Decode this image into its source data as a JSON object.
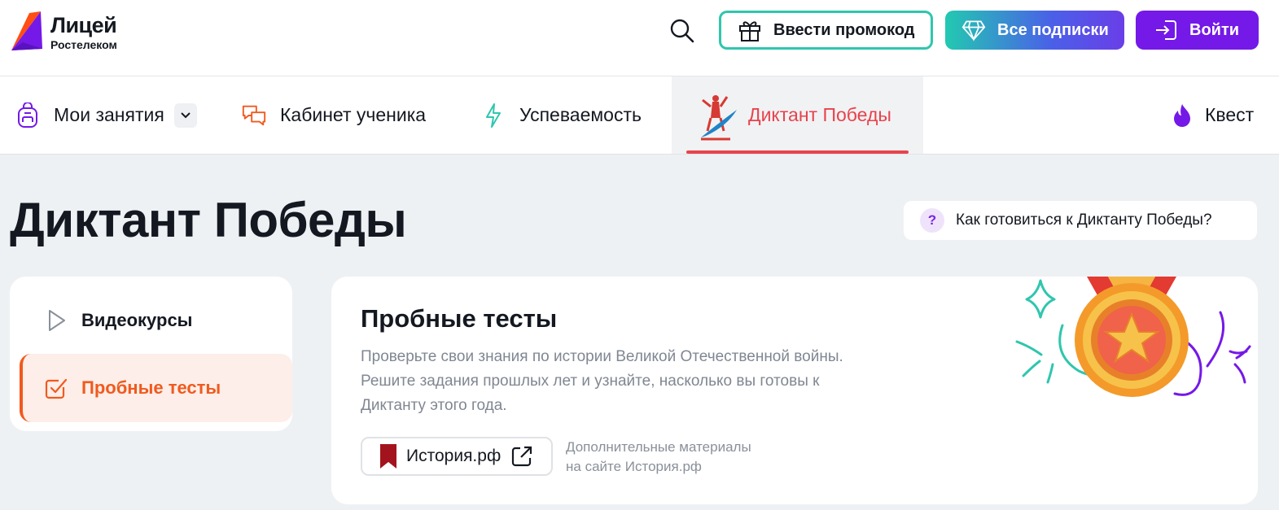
{
  "header": {
    "logo_title": "Лицей",
    "logo_subtitle": "Ростелеком",
    "promo_label": "Ввести промокод",
    "subscriptions_label": "Все подписки",
    "login_label": "Войти"
  },
  "nav": {
    "items": [
      {
        "label": "Мои занятия"
      },
      {
        "label": "Кабинет ученика"
      },
      {
        "label": "Успеваемость"
      },
      {
        "label": "Диктант Победы"
      },
      {
        "label": "Квест"
      }
    ],
    "active": "Диктант Победы"
  },
  "page": {
    "title": "Диктант Победы",
    "help_label": "Как готовиться к Диктанту Победы?"
  },
  "side_menu": {
    "items": [
      {
        "label": "Видеокурсы"
      },
      {
        "label": "Пробные тесты"
      }
    ],
    "active": "Пробные тесты"
  },
  "card": {
    "title": "Пробные тесты",
    "description_lines": [
      "Проверьте свои знания по истории Великой Отечественной войны.",
      "Решите задания прошлых лет и узнайте, насколько вы готовы к",
      "Диктанту этого года."
    ],
    "link_label": "История.рф",
    "link_note_lines": [
      "Дополнительные материалы",
      "на сайте История.рф"
    ]
  },
  "colors": {
    "accent_purple": "#7419e8",
    "accent_teal": "#2fc6ae",
    "accent_red": "#e8434b",
    "accent_orange": "#f05a1e"
  },
  "icons": {
    "search": "search-icon",
    "gift": "gift-icon",
    "diamond": "diamond-icon",
    "login": "login-icon",
    "backpack": "backpack-icon",
    "chat": "chat-icon",
    "lightning": "lightning-icon",
    "flame": "flame-icon",
    "play": "play-icon",
    "checkbox": "checkbox-icon",
    "external": "external-link-icon",
    "medal": "medal-icon"
  }
}
